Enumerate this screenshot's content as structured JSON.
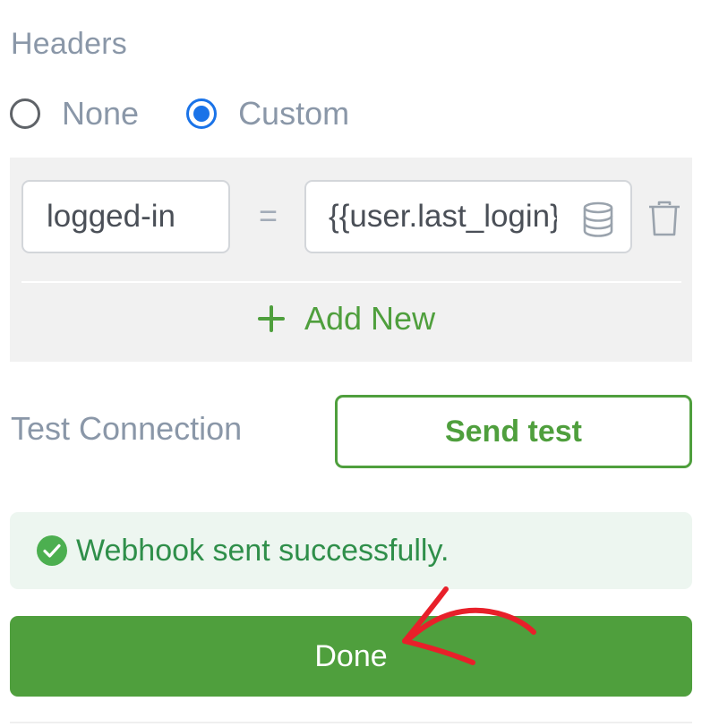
{
  "headers": {
    "title": "Headers",
    "options": [
      {
        "label": "None",
        "selected": false
      },
      {
        "label": "Custom",
        "selected": true
      }
    ],
    "rows": [
      {
        "key": "logged-in",
        "operator": "=",
        "value": "{{user.last_login}}"
      }
    ],
    "add_new_label": "Add New"
  },
  "test_connection": {
    "label": "Test Connection",
    "button_label": "Send test"
  },
  "status": {
    "message": "Webhook sent successfully.",
    "color": "#2f8f4a"
  },
  "actions": {
    "done_label": "Done"
  },
  "icons": {
    "variable": "database-icon",
    "delete": "trash-icon",
    "add": "plus-icon",
    "success": "check-circle-icon",
    "annotation": "red-arrow-icon"
  },
  "colors": {
    "accent_green": "#4f9f3d",
    "radio_blue": "#1a73e8",
    "muted_text": "#8a97a8",
    "annotation_red": "#e8202a"
  }
}
